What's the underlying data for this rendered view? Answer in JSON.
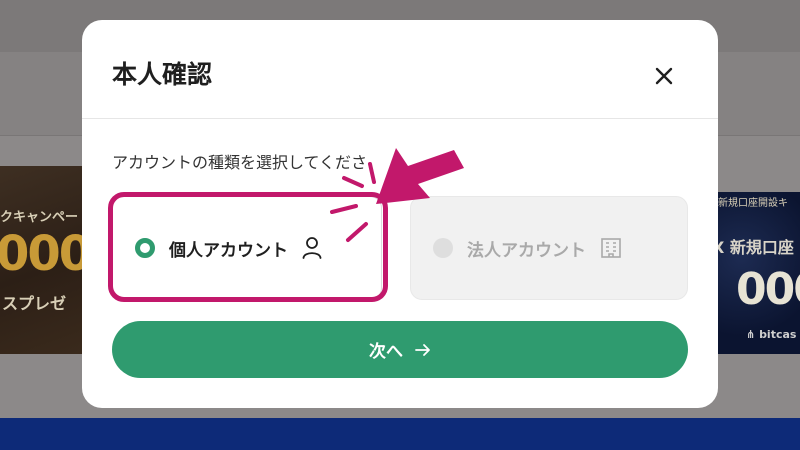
{
  "background": {
    "left_banner": {
      "line1": "クキャンペー",
      "big": "000",
      "line3": "スプレゼ"
    },
    "right_banner": {
      "line1": "新規口座開設キ",
      "line2": "X 新規口座",
      "big": "000",
      "brand": "bitcas"
    }
  },
  "modal": {
    "title": "本人確認",
    "close_icon": "close-icon",
    "prompt": "アカウントの種類を選択してくださ",
    "options": [
      {
        "label": "個人アカウント",
        "icon": "person-icon",
        "selected": true
      },
      {
        "label": "法人アカウント",
        "icon": "building-icon",
        "selected": false
      }
    ],
    "next_button": {
      "label": "次へ",
      "icon": "arrow-right-icon"
    }
  },
  "colors": {
    "accent_green": "#2f9b6f",
    "highlight_magenta": "#c2186b",
    "footer_navy": "#0d2a78"
  }
}
